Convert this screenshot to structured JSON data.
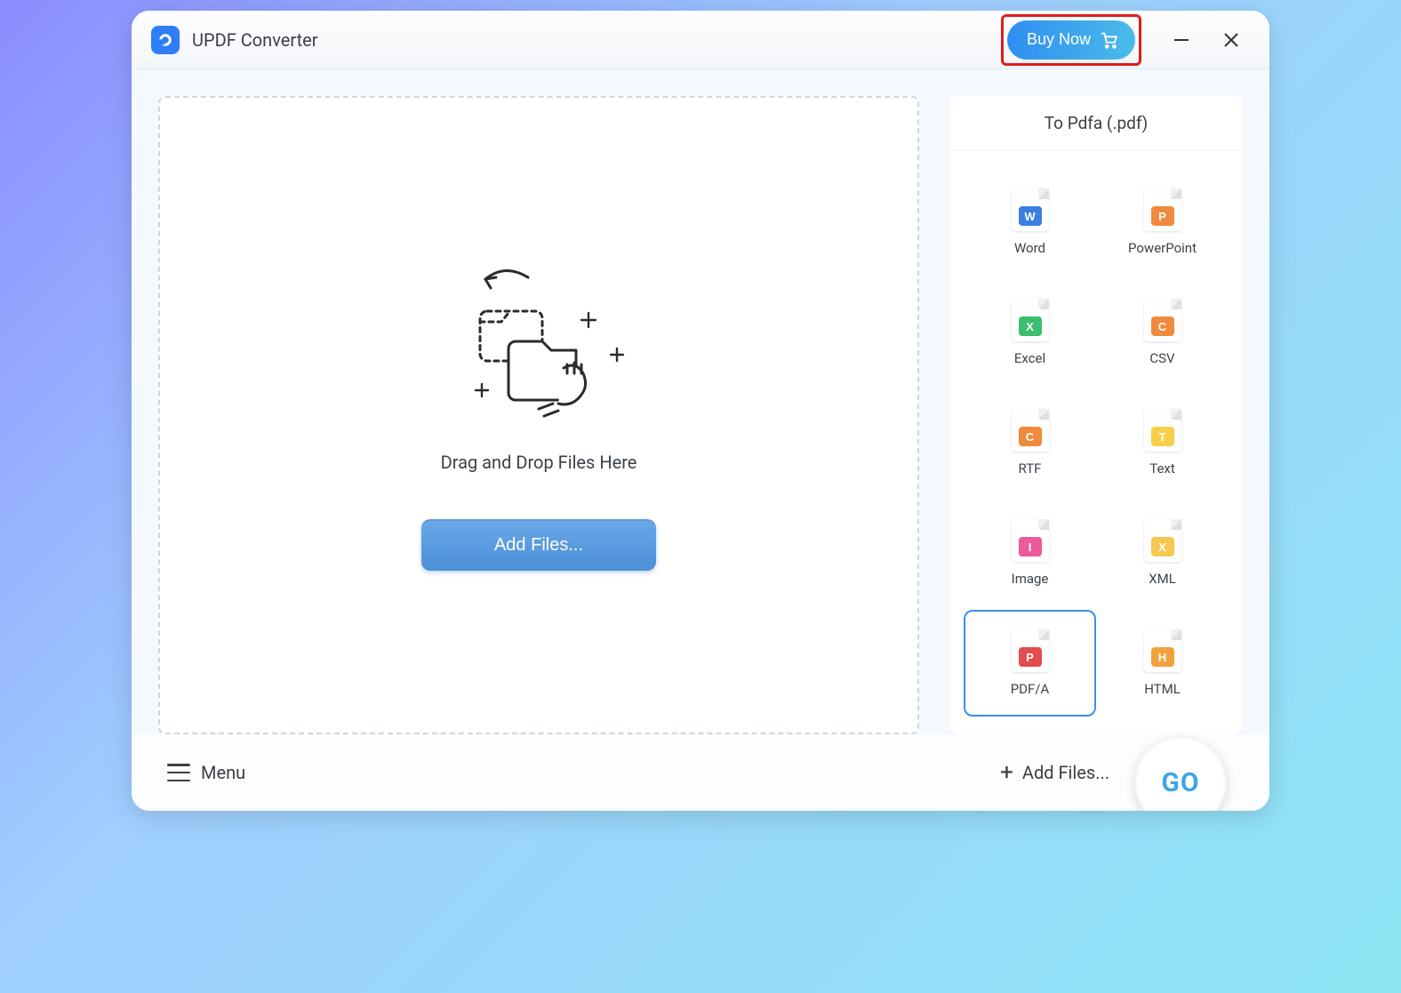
{
  "app": {
    "title": "UPDF Converter"
  },
  "titlebar": {
    "buy_label": "Buy Now"
  },
  "dropzone": {
    "hint": "Drag and Drop Files Here",
    "add_button": "Add Files..."
  },
  "sidebar": {
    "header": "To Pdfa (.pdf)",
    "formats": [
      {
        "label": "Word",
        "glyph": "W",
        "cls": "bg-word",
        "selected": false
      },
      {
        "label": "PowerPoint",
        "glyph": "P",
        "cls": "bg-ppt",
        "selected": false
      },
      {
        "label": "Excel",
        "glyph": "X",
        "cls": "bg-excel",
        "selected": false
      },
      {
        "label": "CSV",
        "glyph": "C",
        "cls": "bg-csv",
        "selected": false
      },
      {
        "label": "RTF",
        "glyph": "C",
        "cls": "bg-rtf",
        "selected": false
      },
      {
        "label": "Text",
        "glyph": "T",
        "cls": "bg-text",
        "selected": false
      },
      {
        "label": "Image",
        "glyph": "I",
        "cls": "bg-image",
        "selected": false
      },
      {
        "label": "XML",
        "glyph": "X",
        "cls": "bg-xml",
        "selected": false
      },
      {
        "label": "PDF/A",
        "glyph": "P",
        "cls": "bg-pdfa",
        "selected": true
      },
      {
        "label": "HTML",
        "glyph": "H",
        "cls": "bg-html",
        "selected": false
      }
    ]
  },
  "bottombar": {
    "menu_label": "Menu",
    "add_files_label": "Add Files...",
    "go_label": "GO"
  }
}
